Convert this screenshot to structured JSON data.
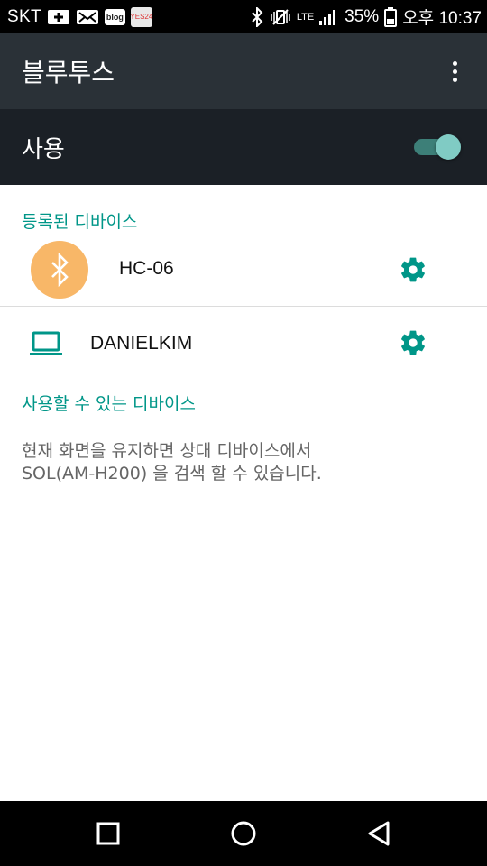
{
  "status_bar": {
    "carrier": "SKT",
    "blog_badge": "blog",
    "yes24_badge": "YES24",
    "network_type": "LTE",
    "battery_percent": "35%",
    "time": "오후 10:37"
  },
  "app_bar": {
    "title": "블루투스",
    "more_icon": "more-vert-icon"
  },
  "master_switch": {
    "label": "사용",
    "enabled": true,
    "accent_color": "#80cbc4"
  },
  "registered_devices": {
    "header": "등록된 디바이스",
    "items": [
      {
        "name": "HC-06",
        "icon": "bluetooth-icon",
        "settings_icon": "gear-icon"
      },
      {
        "name": "DANIELKIM",
        "icon": "laptop-icon",
        "settings_icon": "gear-icon"
      }
    ]
  },
  "available_devices": {
    "header": "사용할 수 있는 디바이스",
    "info_line1": "현재 화면을 유지하면 상대 디바이스에서",
    "info_line2": "SOL(AM-H200) 을 검색 할 수 있습니다."
  },
  "nav_bar": {
    "recents_icon": "recents-square-icon",
    "home_icon": "home-circle-icon",
    "back_icon": "back-triangle-icon"
  },
  "colors": {
    "accent": "#009688",
    "app_bar": "#2a3137",
    "switch_bar": "#1b2026",
    "bt_avatar": "#f8b768"
  }
}
